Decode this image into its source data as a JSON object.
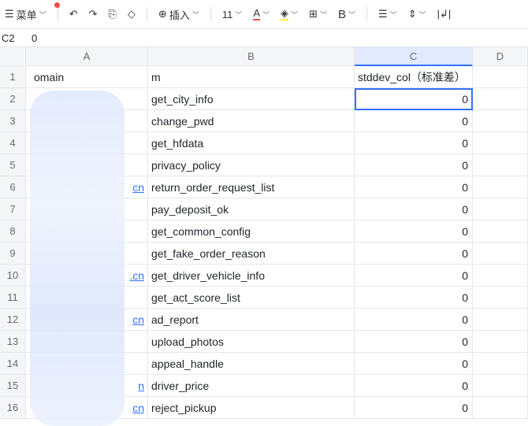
{
  "toolbar": {
    "menu": "菜单",
    "insert": "插入",
    "font_size": "11",
    "bold": "B",
    "font_color": "A"
  },
  "formula_bar": {
    "cell_ref": "C2",
    "value": "0"
  },
  "columns": [
    "A",
    "B",
    "C",
    "D"
  ],
  "header_row": {
    "a": "omain",
    "b": "m",
    "c": "stddev_col（标准差）"
  },
  "rows": [
    {
      "n": "2",
      "a": "",
      "b": "get_city_info",
      "c": "0"
    },
    {
      "n": "3",
      "a": "",
      "b": "change_pwd",
      "c": "0"
    },
    {
      "n": "4",
      "a": "",
      "b": "get_hfdata",
      "c": "0"
    },
    {
      "n": "5",
      "a": "",
      "b": "privacy_policy",
      "c": "0"
    },
    {
      "n": "6",
      "a": "cn",
      "b": "return_order_request_list",
      "c": "0"
    },
    {
      "n": "7",
      "a": "",
      "b": "pay_deposit_ok",
      "c": "0"
    },
    {
      "n": "8",
      "a": "",
      "b": "get_common_config",
      "c": "0"
    },
    {
      "n": "9",
      "a": "",
      "b": "get_fake_order_reason",
      "c": "0"
    },
    {
      "n": "10",
      "a": ".cn",
      "b": "get_driver_vehicle_info",
      "c": "0"
    },
    {
      "n": "11",
      "a": "",
      "b": "get_act_score_list",
      "c": "0"
    },
    {
      "n": "12",
      "a": "cn",
      "b": "ad_report",
      "c": "0"
    },
    {
      "n": "13",
      "a": "",
      "b": "upload_photos",
      "c": "0"
    },
    {
      "n": "14",
      "a": "",
      "b": "appeal_handle",
      "c": "0"
    },
    {
      "n": "15",
      "a": "n",
      "b": "driver_price",
      "c": "0"
    },
    {
      "n": "16",
      "a": "cn",
      "b": "reject_pickup",
      "c": "0"
    }
  ]
}
